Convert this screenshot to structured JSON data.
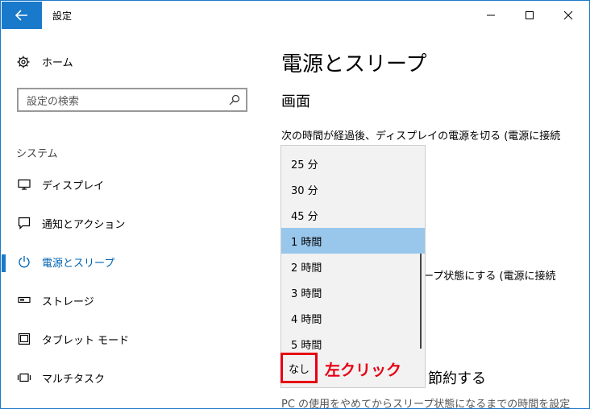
{
  "window": {
    "title": "設定"
  },
  "sidebar": {
    "home_label": "ホーム",
    "search_placeholder": "設定の検索",
    "group_label": "システム",
    "items": [
      {
        "label": "ディスプレイ",
        "icon": "monitor-icon"
      },
      {
        "label": "通知とアクション",
        "icon": "notification-icon"
      },
      {
        "label": "電源とスリープ",
        "icon": "power-icon"
      },
      {
        "label": "ストレージ",
        "icon": "storage-icon"
      },
      {
        "label": "タブレット モード",
        "icon": "tablet-icon"
      },
      {
        "label": "マルチタスク",
        "icon": "multitask-icon"
      }
    ]
  },
  "content": {
    "page_title": "電源とスリープ",
    "section_screen": "画面",
    "screen_desc": "次の時間が経過後、ディスプレイの電源を切る (電源に接続",
    "sleep_desc_partial": "ープ状態にする (電源に接続",
    "section_partial": "節約する",
    "footer_text": "PC の使用をやめてからスリープ状態になるまでの時間を設定"
  },
  "dropdown": {
    "options": [
      "25 分",
      "30 分",
      "45 分",
      "1 時間",
      "2 時間",
      "3 時間",
      "4 時間",
      "5 時間",
      "なし"
    ],
    "selected_index": 3
  },
  "annotation": {
    "label": "左クリック",
    "color": "#e60012"
  },
  "colors": {
    "accent": "#1979ca",
    "selected_bg": "#99c7ec",
    "active_text": "#0063b1"
  }
}
